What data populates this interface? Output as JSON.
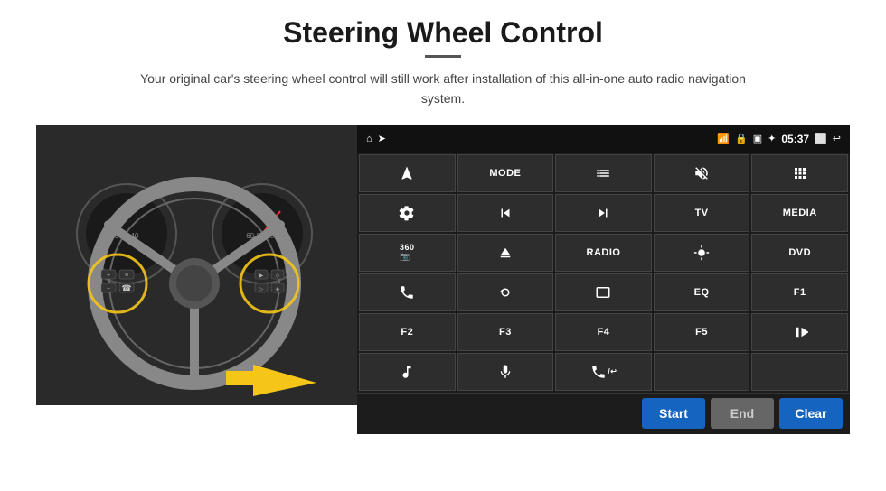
{
  "header": {
    "title": "Steering Wheel Control",
    "underline": true,
    "subtitle": "Your original car's steering wheel control will still work after installation of this all-in-one auto radio navigation system."
  },
  "status_bar": {
    "time": "05:37",
    "icons": [
      "home",
      "wifi",
      "lock",
      "sim",
      "bluetooth",
      "cast",
      "back"
    ]
  },
  "button_rows": [
    [
      {
        "label": "",
        "icon": "navigation"
      },
      {
        "label": "MODE",
        "icon": ""
      },
      {
        "label": "",
        "icon": "list"
      },
      {
        "label": "",
        "icon": "mute"
      },
      {
        "label": "",
        "icon": "apps"
      }
    ],
    [
      {
        "label": "",
        "icon": "settings-circle"
      },
      {
        "label": "",
        "icon": "prev"
      },
      {
        "label": "",
        "icon": "next"
      },
      {
        "label": "TV",
        "icon": ""
      },
      {
        "label": "MEDIA",
        "icon": ""
      }
    ],
    [
      {
        "label": "",
        "icon": "360-cam"
      },
      {
        "label": "",
        "icon": "eject"
      },
      {
        "label": "RADIO",
        "icon": ""
      },
      {
        "label": "",
        "icon": "brightness"
      },
      {
        "label": "DVD",
        "icon": ""
      }
    ],
    [
      {
        "label": "",
        "icon": "phone"
      },
      {
        "label": "",
        "icon": "swipe"
      },
      {
        "label": "",
        "icon": "window"
      },
      {
        "label": "EQ",
        "icon": ""
      },
      {
        "label": "F1",
        "icon": ""
      }
    ],
    [
      {
        "label": "F2",
        "icon": ""
      },
      {
        "label": "F3",
        "icon": ""
      },
      {
        "label": "F4",
        "icon": ""
      },
      {
        "label": "F5",
        "icon": ""
      },
      {
        "label": "",
        "icon": "play-pause"
      }
    ],
    [
      {
        "label": "",
        "icon": "music"
      },
      {
        "label": "",
        "icon": "mic"
      },
      {
        "label": "",
        "icon": "call-end"
      },
      {
        "label": "",
        "icon": ""
      },
      {
        "label": "",
        "icon": ""
      }
    ]
  ],
  "bottom_buttons": {
    "start": "Start",
    "end": "End",
    "clear": "Clear"
  }
}
